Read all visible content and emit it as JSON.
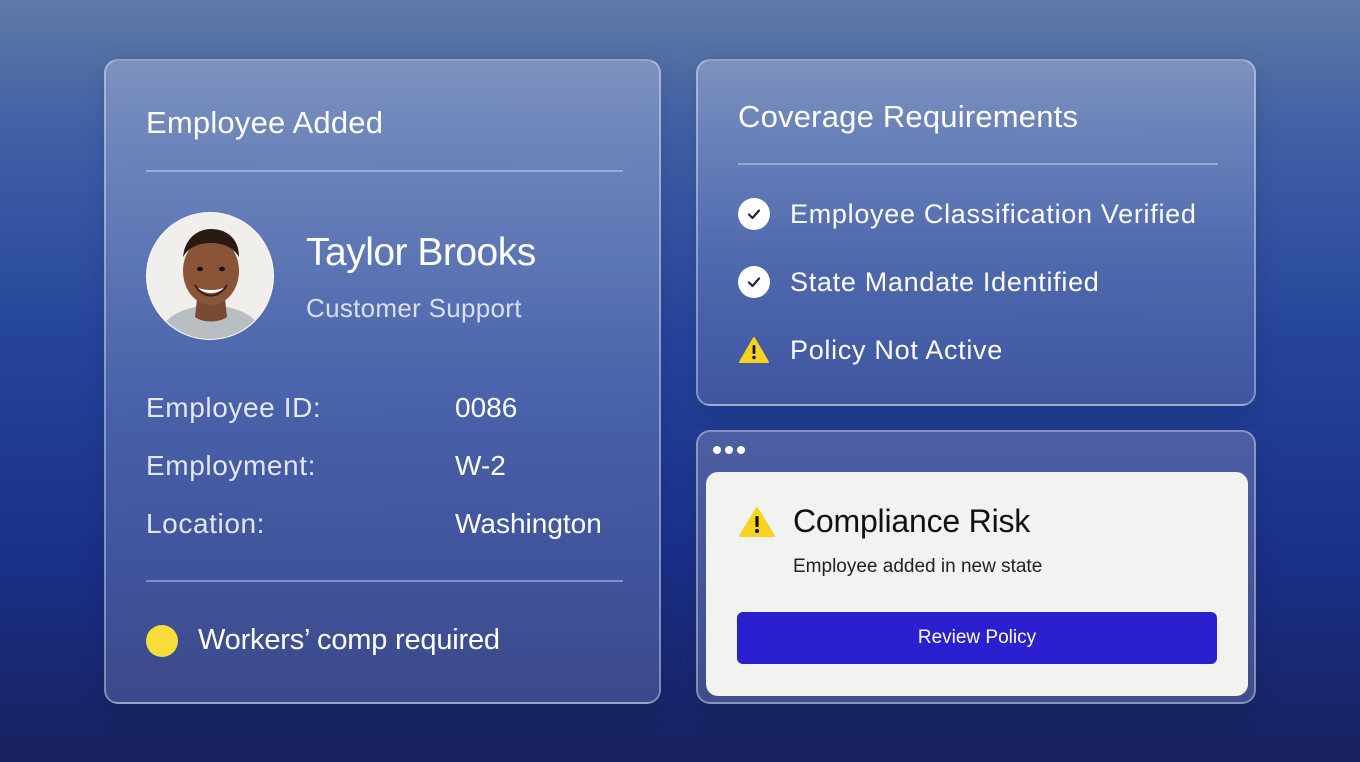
{
  "employee_card": {
    "title": "Employee Added",
    "name": "Taylor Brooks",
    "department": "Customer Support",
    "fields": [
      {
        "label": "Employee ID:",
        "value": "0086"
      },
      {
        "label": "Employment:",
        "value": "W-2"
      },
      {
        "label": "Location:",
        "value": "Washington"
      }
    ],
    "status": {
      "text": "Workers’ comp required",
      "dot_color": "#f7dd3a"
    }
  },
  "coverage_card": {
    "title": "Coverage Requirements",
    "items": [
      {
        "label": "Employee Classification Verified",
        "icon": "check-circle-icon"
      },
      {
        "label": "State Mandate Identified",
        "icon": "check-circle-icon"
      },
      {
        "label": "Policy Not Active",
        "icon": "warning-icon"
      }
    ]
  },
  "alert": {
    "title": "Compliance Risk",
    "message": "Employee added in new state",
    "button_label": "Review Policy",
    "button_color": "#2a20cf",
    "warning_color": "#f7d21e"
  }
}
